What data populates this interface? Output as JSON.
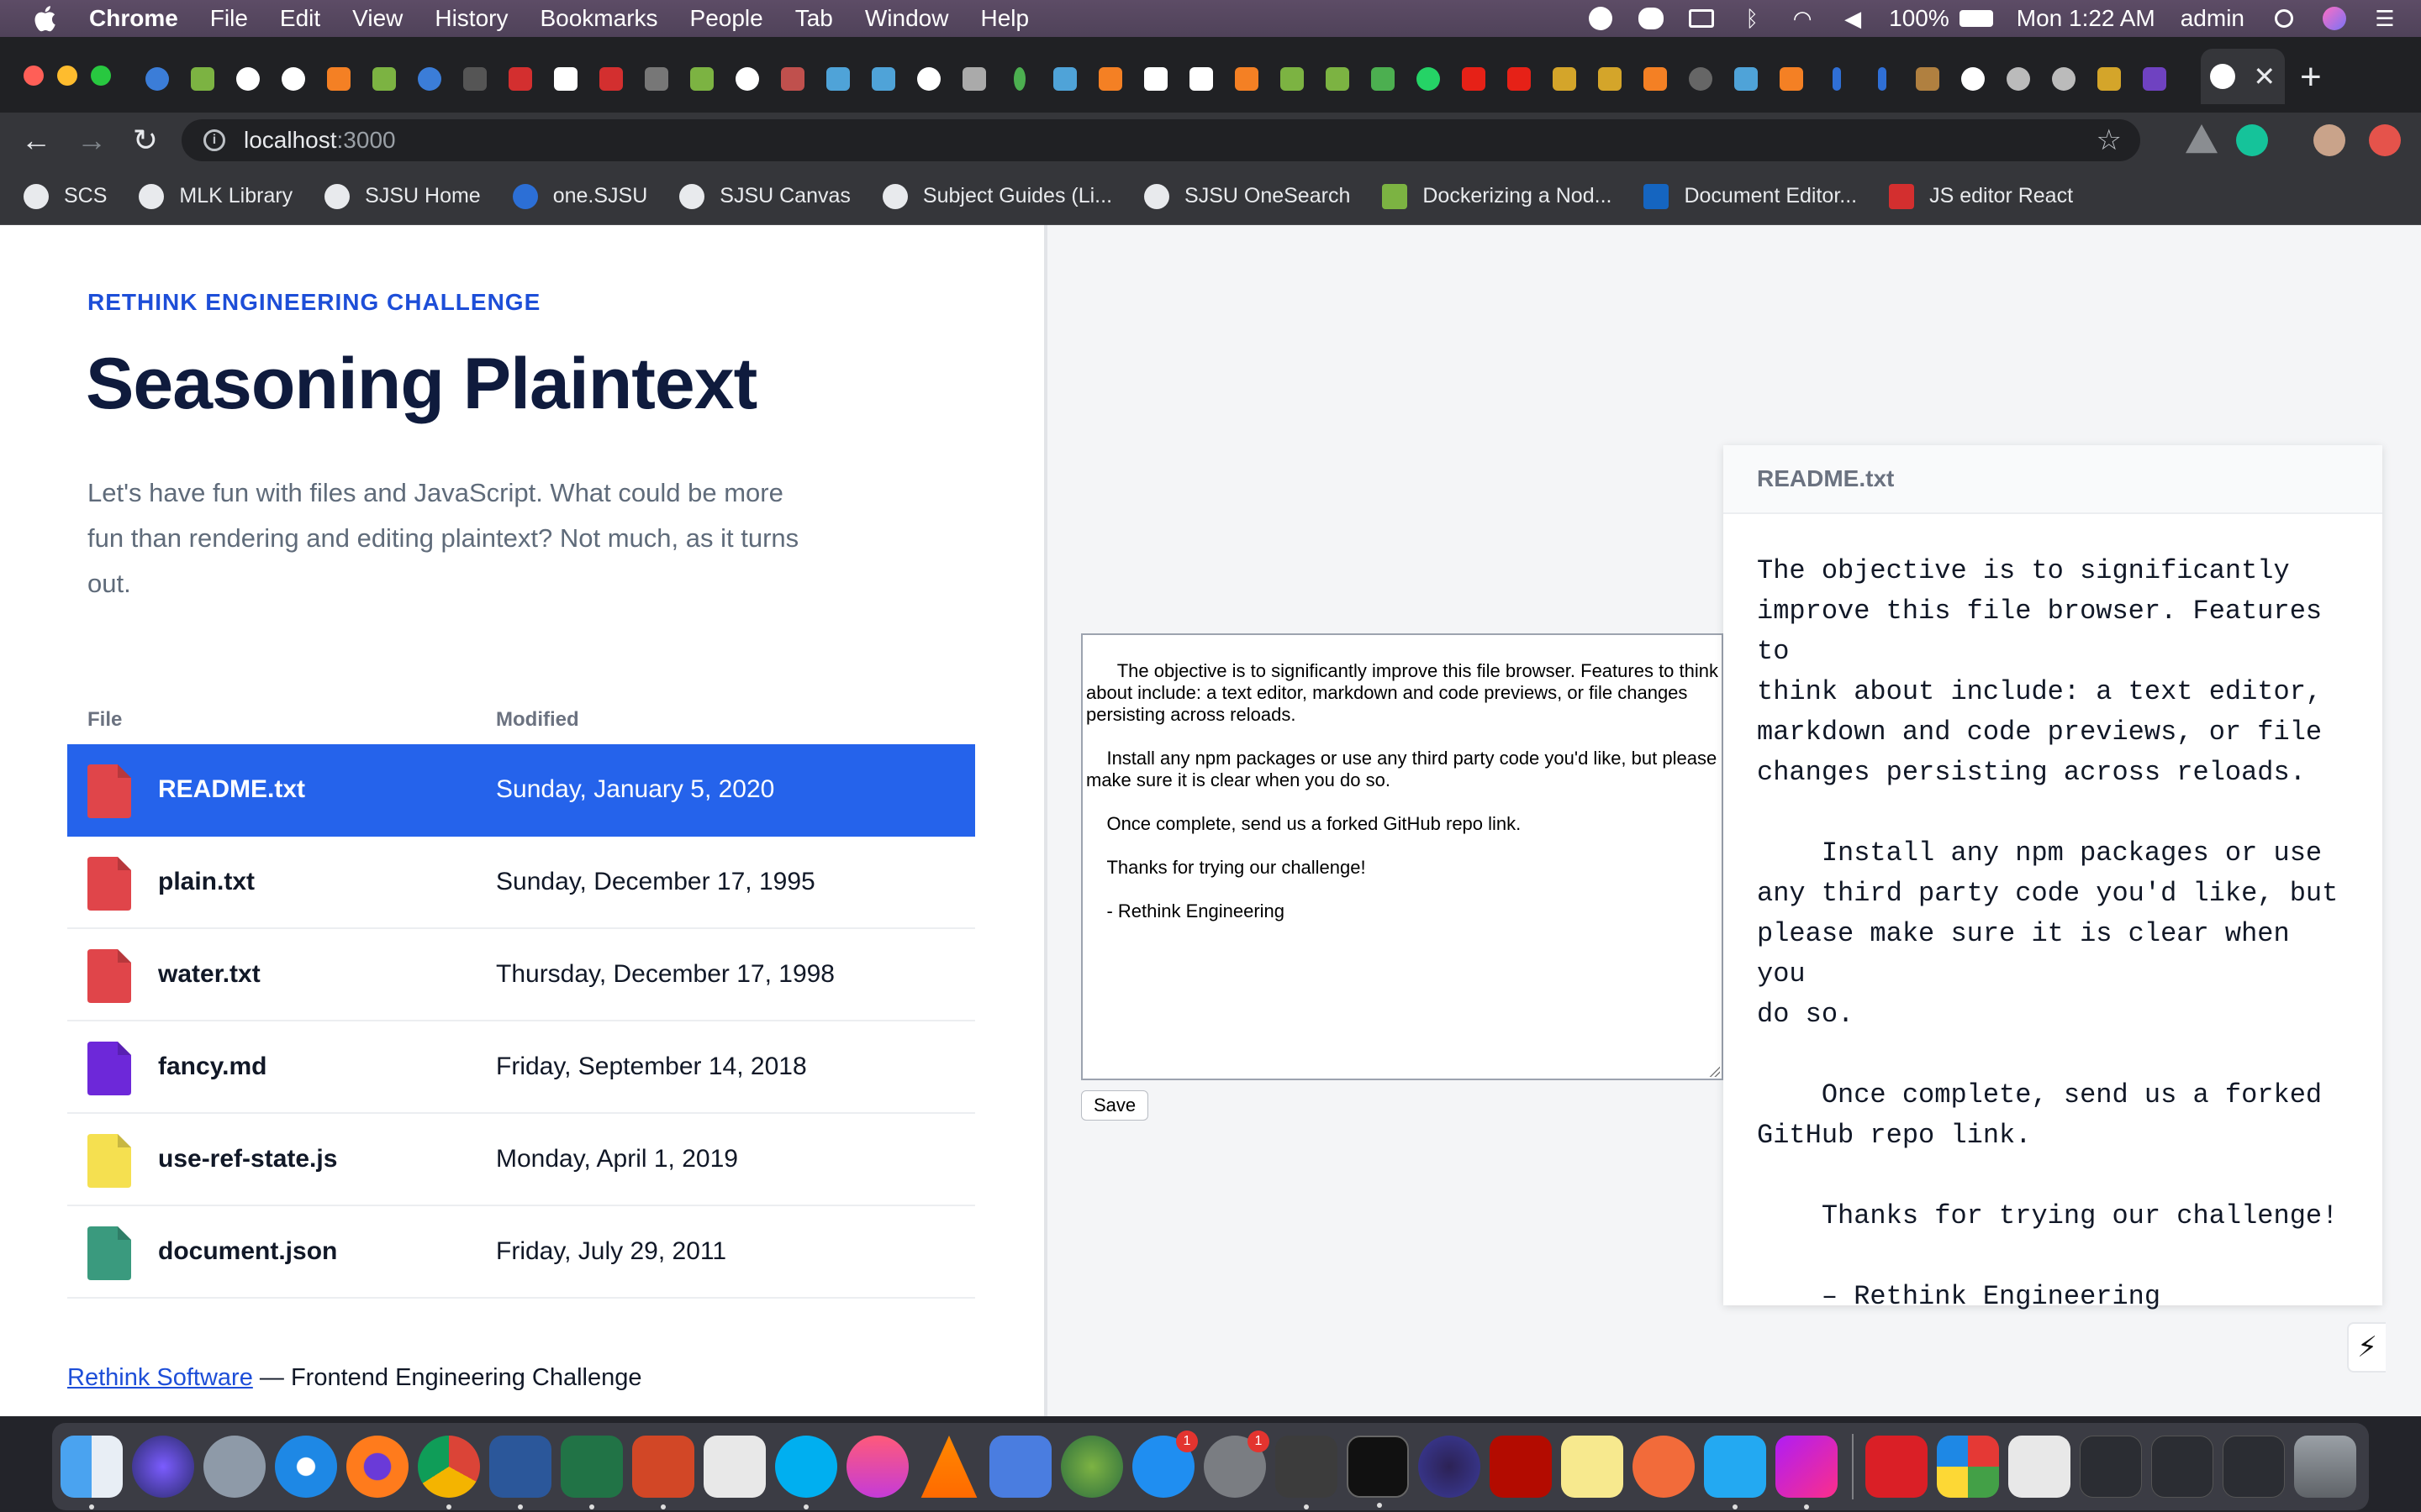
{
  "menubar": {
    "app_name": "Chrome",
    "items": [
      "File",
      "Edit",
      "View",
      "History",
      "Bookmarks",
      "People",
      "Tab",
      "Window",
      "Help"
    ],
    "battery": "100%",
    "clock": "Mon 1:22 AM",
    "user": "admin"
  },
  "browser": {
    "url_host": "localhost",
    "url_port": ":3000",
    "tab_close": "✕",
    "new_tab": "+"
  },
  "bookmarks": [
    {
      "label": "SCS",
      "color": "#e8eaed"
    },
    {
      "label": "MLK Library",
      "color": "#e8eaed"
    },
    {
      "label": "SJSU Home",
      "color": "#e8eaed"
    },
    {
      "label": "one.SJSU",
      "color": "#2c6fd6"
    },
    {
      "label": "SJSU Canvas",
      "color": "#e8eaed"
    },
    {
      "label": "Subject Guides (Li...",
      "color": "#e8eaed"
    },
    {
      "label": "SJSU OneSearch",
      "color": "#e8eaed"
    },
    {
      "label": "Dockerizing a Nod...",
      "color": "#7cb342"
    },
    {
      "label": "Document Editor...",
      "color": "#1565c0"
    },
    {
      "label": "JS editor React",
      "color": "#d32f2f"
    }
  ],
  "page": {
    "eyebrow": "RETHINK ENGINEERING CHALLENGE",
    "title": "Seasoning Plaintext",
    "intro": "Let's have fun with files and JavaScript. What could be more fun than rendering and editing plaintext? Not much, as it turns out."
  },
  "file_table": {
    "headers": {
      "file": "File",
      "modified": "Modified"
    },
    "rows": [
      {
        "name": "README.txt",
        "modified": "Sunday, January 5, 2020",
        "icon_color": "#e0454a",
        "selected": true
      },
      {
        "name": "plain.txt",
        "modified": "Sunday, December 17, 1995",
        "icon_color": "#e0454a",
        "selected": false
      },
      {
        "name": "water.txt",
        "modified": "Thursday, December 17, 1998",
        "icon_color": "#e0454a",
        "selected": false
      },
      {
        "name": "fancy.md",
        "modified": "Friday, September 14, 2018",
        "icon_color": "#6d28d9",
        "selected": false
      },
      {
        "name": "use-ref-state.js",
        "modified": "Monday, April 1, 2019",
        "icon_color": "#f5e050",
        "selected": false
      },
      {
        "name": "document.json",
        "modified": "Friday, July 29, 2011",
        "icon_color": "#3a9a7e",
        "selected": false
      }
    ]
  },
  "editor": {
    "content": "The objective is to significantly improve this file browser. Features to think about include: a text editor, markdown and code previews, or file changes persisting across reloads.\n\n    Install any npm packages or use any third party code you'd like, but please make sure it is clear when you do so.\n\n    Once complete, send us a forked GitHub repo link.\n\n    Thanks for trying our challenge!\n\n    - Rethink Engineering",
    "save_label": "Save"
  },
  "preview": {
    "filename": "README.txt",
    "content": "The objective is to significantly\nimprove this file browser. Features to\nthink about include: a text editor,\nmarkdown and code previews, or file\nchanges persisting across reloads.\n\n    Install any npm packages or use\nany third party code you'd like, but\nplease make sure it is clear when you\ndo so.\n\n    Once complete, send us a forked\nGitHub repo link.\n\n    Thanks for trying our challenge!\n\n    – Rethink Engineering"
  },
  "footer": {
    "link_text": "Rethink Software",
    "rest": " — Frontend Engineering Challenge"
  },
  "dock": {
    "badges": [
      "1",
      "1"
    ]
  }
}
